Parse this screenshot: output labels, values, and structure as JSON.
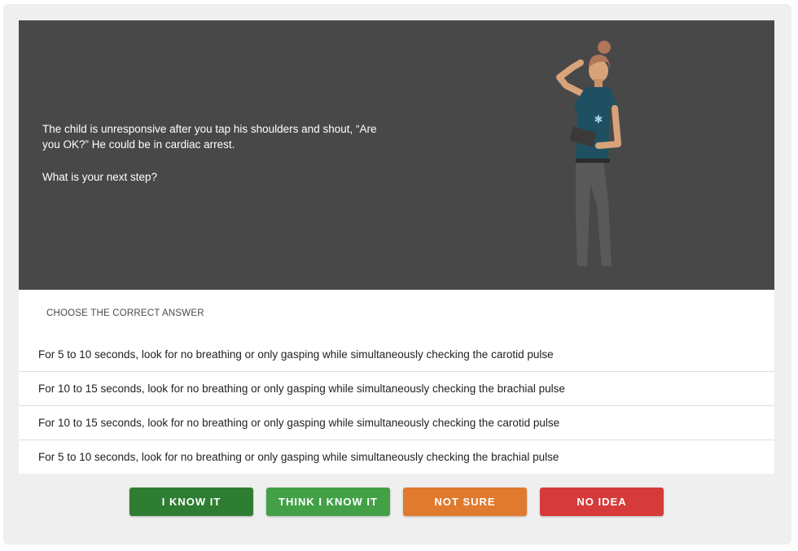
{
  "question": {
    "line1": "The child is unresponsive after you tap his shoulders and shout, “Are you OK?” He could be in cardiac arrest.",
    "line2": "What is your next step?"
  },
  "illustration": {
    "subject": "medic-with-tablet-illustration",
    "icon": "star-of-life-icon"
  },
  "answers": {
    "heading": "CHOOSE THE CORRECT ANSWER",
    "options": [
      "For 5 to 10 seconds, look for no breathing or only gasping while simultaneously checking the carotid pulse",
      "For 10 to 15 seconds, look for no breathing or only gasping while simultaneously checking the brachial pulse",
      "For 10 to 15 seconds, look for no breathing or only gasping while simultaneously checking the carotid pulse",
      "For 5 to 10 seconds, look for no breathing or only gasping while simultaneously checking the brachial pulse"
    ]
  },
  "confidence": {
    "buttons": [
      {
        "label": "I KNOW IT",
        "color": "#2e7d32"
      },
      {
        "label": "THINK I KNOW IT",
        "color": "#43a047"
      },
      {
        "label": "NOT SURE",
        "color": "#e07a2e"
      },
      {
        "label": "NO IDEA",
        "color": "#d63a3a"
      }
    ]
  }
}
